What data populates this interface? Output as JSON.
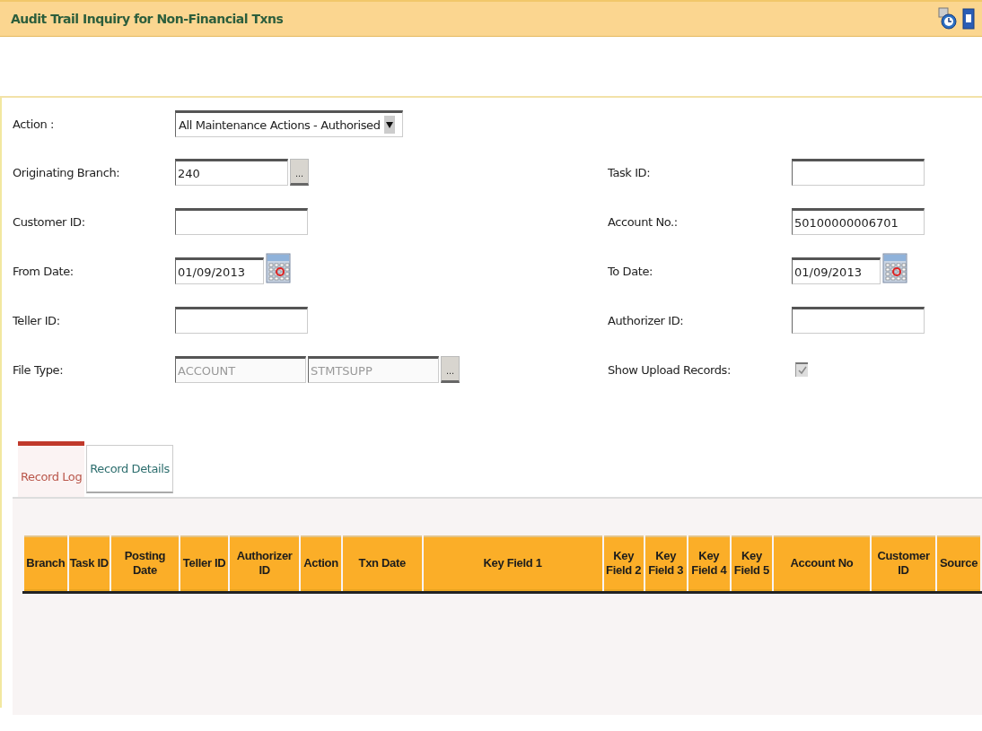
{
  "window": {
    "title": "Audit Trail Inquiry for Non-Financial Txns"
  },
  "form_rows": [
    {
      "left": {
        "label": "Action :",
        "kind": "select",
        "value": "All Maintenance Actions - Authorised"
      }
    },
    {
      "left": {
        "label": "Originating Branch:",
        "kind": "lookup",
        "value": "240",
        "button": "..."
      },
      "right": {
        "label": "Task ID:",
        "kind": "text"
      }
    },
    {
      "left": {
        "label": "Customer ID:",
        "kind": "text"
      },
      "right": {
        "label": "Account No.:",
        "kind": "text",
        "value": "50100000006701"
      }
    },
    {
      "left": {
        "label": "From Date:",
        "kind": "date",
        "value": "01/09/2013"
      },
      "right": {
        "label": "To Date:",
        "kind": "date",
        "value": "01/09/2013"
      }
    },
    {
      "left": {
        "label": "Teller ID:",
        "kind": "text"
      },
      "right": {
        "label": "Authorizer ID:",
        "kind": "text"
      }
    },
    {
      "left": {
        "label": "File Type:",
        "kind": "filetype",
        "values": [
          "ACCOUNT",
          "STMTSUPP"
        ],
        "disabled": true,
        "button": "..."
      },
      "right": {
        "label": "Show Upload Records:",
        "kind": "checkbox",
        "checked": true,
        "disabled": true
      }
    }
  ],
  "tabs": [
    {
      "label": "Record Log",
      "selected": true
    },
    {
      "label": "Record Details",
      "selected": false
    }
  ],
  "table": {
    "columns": [
      "Branch",
      "Task ID",
      "Posting Date",
      "Teller ID",
      "Authorizer ID",
      "Action",
      "Txn Date",
      "Key Field 1",
      "Key Field 2",
      "Key Field 3",
      "Key Field 4",
      "Key Field 5",
      "Account No",
      "Customer ID",
      "Source"
    ]
  }
}
